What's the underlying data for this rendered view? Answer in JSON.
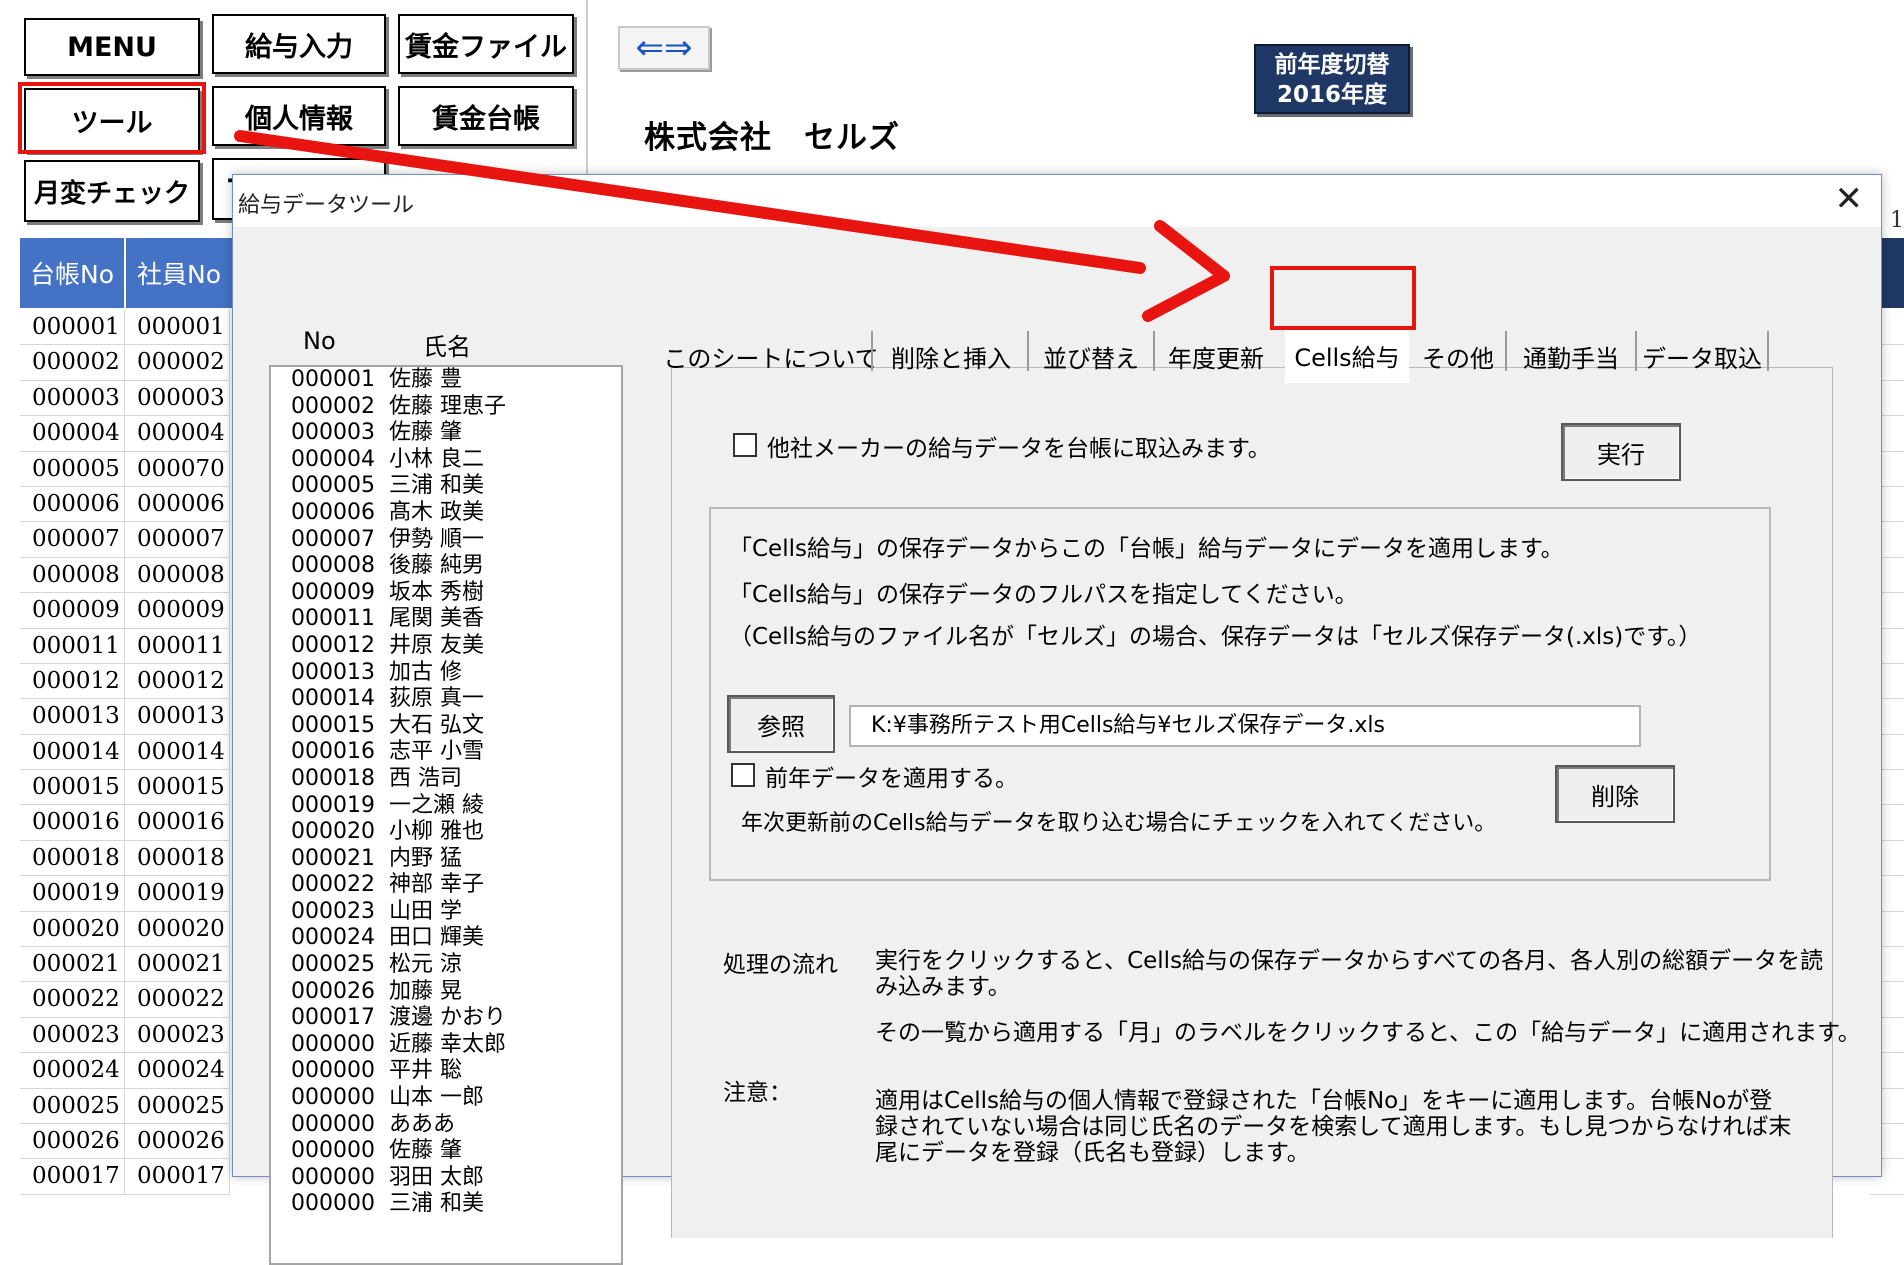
{
  "sheet_buttons": {
    "menu": "MENU",
    "kyuyo_input": "給与入力",
    "chingin_file": "賃金ファイル",
    "tool": "ツール",
    "kojin_joho": "個人情報",
    "chingin_daicho": "賃金台帳",
    "gekkan_check": "月変チェック",
    "partial": "T"
  },
  "swap_arrow": "⇐⇒",
  "year_button": {
    "line1": "前年度切替",
    "line2": "2016年度"
  },
  "company": "株式会社　セルズ",
  "sheet": {
    "headers": [
      "台帳No",
      "社員No"
    ],
    "rows": [
      [
        "000001",
        "000001"
      ],
      [
        "000002",
        "000002"
      ],
      [
        "000003",
        "000003"
      ],
      [
        "000004",
        "000004"
      ],
      [
        "000005",
        "000070"
      ],
      [
        "000006",
        "000006"
      ],
      [
        "000007",
        "000007"
      ],
      [
        "000008",
        "000008"
      ],
      [
        "000009",
        "000009"
      ],
      [
        "000011",
        "000011"
      ],
      [
        "000012",
        "000012"
      ],
      [
        "000013",
        "000013"
      ],
      [
        "000014",
        "000014"
      ],
      [
        "000015",
        "000015"
      ],
      [
        "000016",
        "000016"
      ],
      [
        "000018",
        "000018"
      ],
      [
        "000019",
        "000019"
      ],
      [
        "000020",
        "000020"
      ],
      [
        "000021",
        "000021"
      ],
      [
        "000022",
        "000022"
      ],
      [
        "000023",
        "000023"
      ],
      [
        "000024",
        "000024"
      ],
      [
        "000025",
        "000025"
      ],
      [
        "000026",
        "000026"
      ],
      [
        "000017",
        "000017"
      ]
    ],
    "right_col_num": "1"
  },
  "dialog": {
    "title": "給与データツール",
    "close": "✕",
    "list_headers": {
      "no": "No",
      "name": "氏名"
    },
    "employees": [
      [
        "000001",
        "佐藤 豊"
      ],
      [
        "000002",
        "佐藤 理恵子"
      ],
      [
        "000003",
        "佐藤 肇"
      ],
      [
        "000004",
        "小林 良二"
      ],
      [
        "000005",
        "三浦 和美"
      ],
      [
        "000006",
        "髙木 政美"
      ],
      [
        "000007",
        "伊勢 順一"
      ],
      [
        "000008",
        "後藤 純男"
      ],
      [
        "000009",
        "坂本 秀樹"
      ],
      [
        "000011",
        "尾関 美香"
      ],
      [
        "000012",
        "井原 友美"
      ],
      [
        "000013",
        "加古 修"
      ],
      [
        "000014",
        "荻原 真一"
      ],
      [
        "000015",
        "大石 弘文"
      ],
      [
        "000016",
        "志平 小雪"
      ],
      [
        "000018",
        "西 浩司"
      ],
      [
        "000019",
        "一之瀬 綾"
      ],
      [
        "000020",
        "小柳 雅也"
      ],
      [
        "000021",
        "内野 猛"
      ],
      [
        "000022",
        "神部 幸子"
      ],
      [
        "000023",
        "山田 学"
      ],
      [
        "000024",
        "田口 輝美"
      ],
      [
        "000025",
        "松元 涼"
      ],
      [
        "000026",
        "加藤 晃"
      ],
      [
        "000017",
        "渡邊 かおり"
      ],
      [
        "000000",
        "近藤 幸太郎"
      ],
      [
        "000000",
        "平井 聡"
      ],
      [
        "000000",
        "山本 一郎"
      ],
      [
        "000000",
        "あああ"
      ],
      [
        "000000",
        "佐藤 肇"
      ],
      [
        "000000",
        "羽田 太郎"
      ],
      [
        "000000",
        "三浦 和美"
      ]
    ],
    "tabs": [
      "このシートについて",
      "削除と挿入",
      "並び替え",
      "年度更新",
      "Cells給与",
      "その他",
      "通勤手当",
      "データ取込"
    ],
    "active_tab": "Cells給与",
    "page": {
      "import_checkbox_label": "他社メーカーの給与データを台帳に取込みます。",
      "run_button": "実行",
      "desc1": "「Cells給与」の保存データからこの「台帳」給与データにデータを適用します。",
      "desc2": "「Cells給与」の保存データのフルパスを指定してください。",
      "desc3": "（Cells給与のファイル名が「セルズ」の場合、保存データは「セルズ保存データ(.xls)です。）",
      "browse_button": "参照",
      "path_value": "K:¥事務所テスト用Cells給与¥セルズ保存データ.xls",
      "prev_year_label": "前年データを適用する。",
      "delete_button": "削除",
      "prev_year_note": "年次更新前のCells給与データを取り込む場合にチェックを入れてください。",
      "flow_label": "処理の流れ",
      "flow_text1a": "実行をクリックすると、Cells給与の保存データからすべての各月、各人別の総額データを読",
      "flow_text1b": "み込みます。",
      "flow_text2": "その一覧から適用する「月」のラベルをクリックすると、この「給与データ」に適用されます。",
      "note_label": "注意：",
      "note_text1": "適用はCells給与の個人情報で登録された「台帳No」をキーに適用します。台帳Noが登",
      "note_text2": "録されていない場合は同じ氏名のデータを検索して適用します。もし見つからなければ末",
      "note_text3": "尾にデータを登録（氏名も登録）します。"
    }
  },
  "colors": {
    "highlight": "#e8140f",
    "header_blue": "#4472c4",
    "year_button": "#1f3764"
  }
}
